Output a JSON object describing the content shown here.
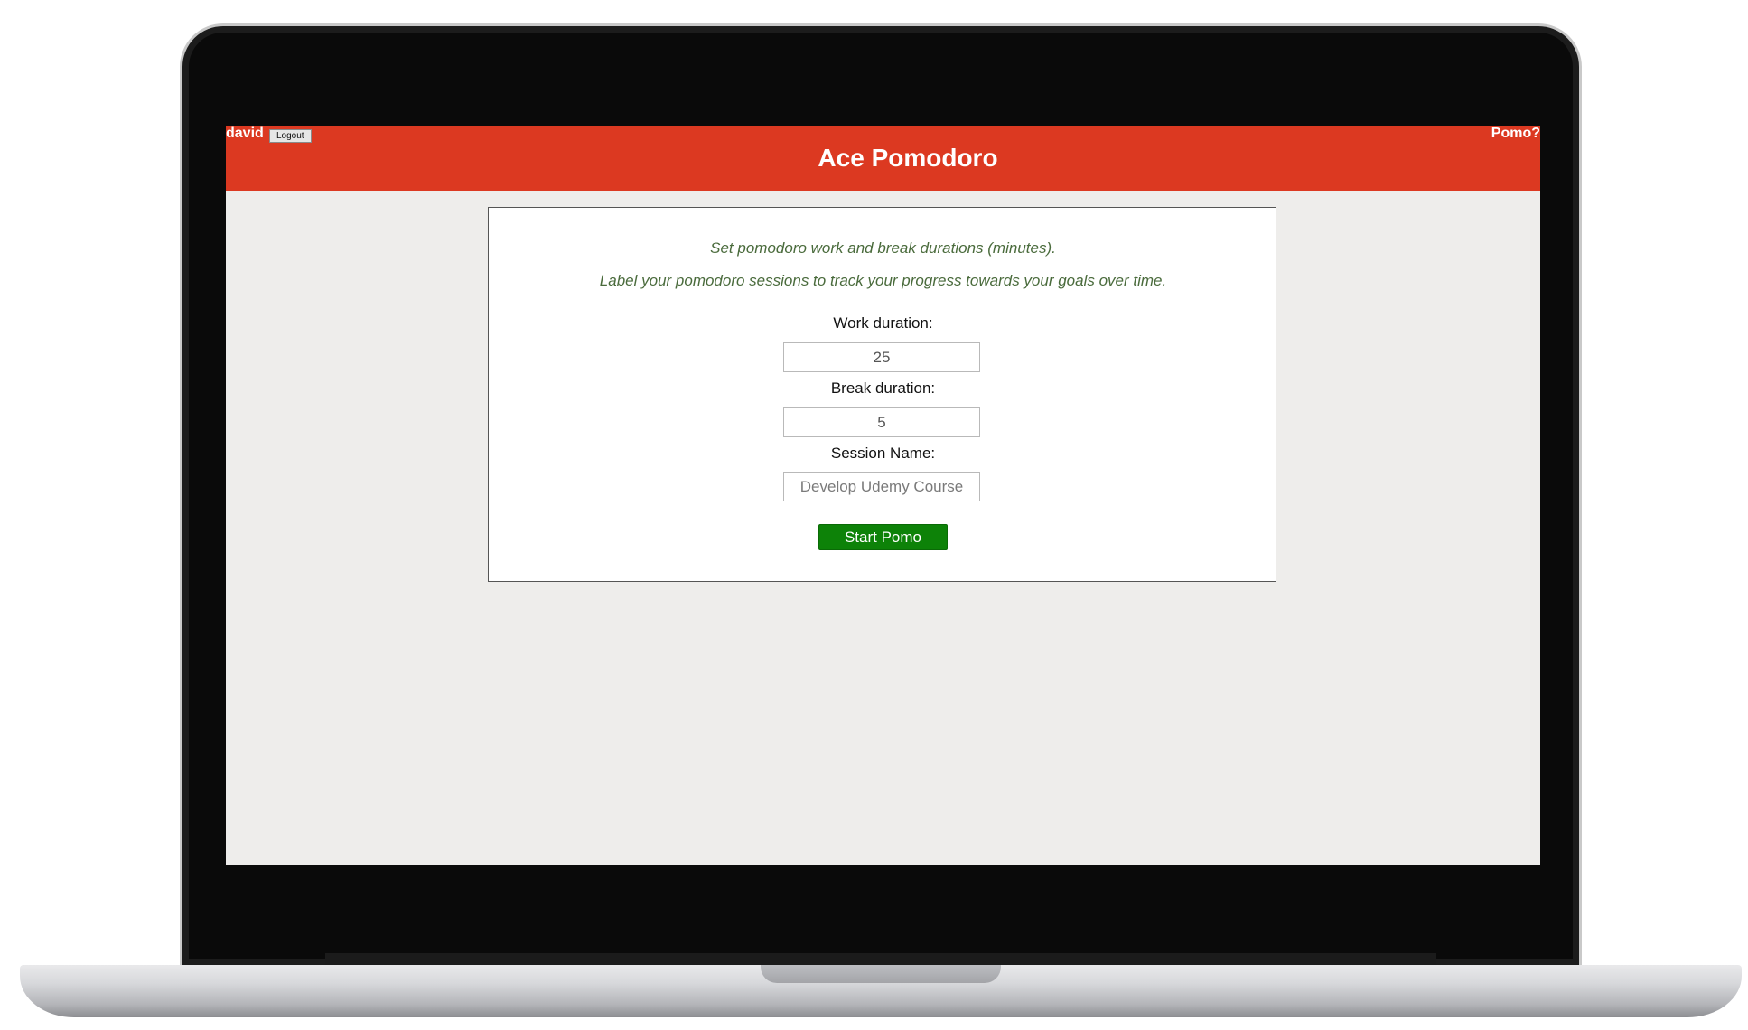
{
  "header": {
    "username": "david",
    "logout_label": "Logout",
    "title": "Ace Pomodoro",
    "pomo_link": "Pomo?"
  },
  "form": {
    "info_line1": "Set pomodoro work and break durations (minutes).",
    "info_line2": "Label your pomodoro sessions to track your progress towards your goals over time.",
    "work_label": "Work duration:",
    "work_value": "25",
    "break_label": "Break duration:",
    "break_value": "5",
    "session_label": "Session Name:",
    "session_placeholder": "Develop Udemy Course",
    "start_label": "Start Pomo"
  },
  "colors": {
    "header_bg": "#dc3921",
    "start_button_bg": "#0d8208",
    "info_text": "#4a6b3c",
    "page_bg": "#eeedeb"
  }
}
